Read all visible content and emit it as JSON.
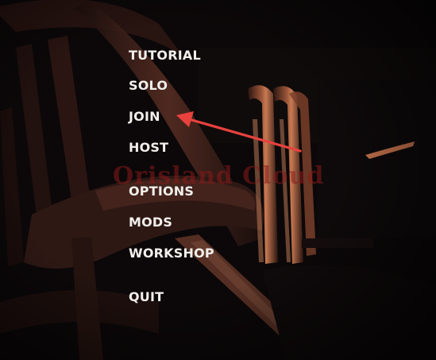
{
  "menu": {
    "tutorial": "TUTORIAL",
    "solo": "SOLO",
    "join": "JOIN",
    "host": "HOST",
    "options": "OPTIONS",
    "mods": "MODS",
    "workshop": "WORKSHOP",
    "quit": "QUIT"
  },
  "watermark": "Orisland Cloud",
  "colors": {
    "menu_text": "#f2efec",
    "annotation_arrow": "#e8423e",
    "chair_wood": "#6b3a2c",
    "highlight": "#c06a45"
  }
}
